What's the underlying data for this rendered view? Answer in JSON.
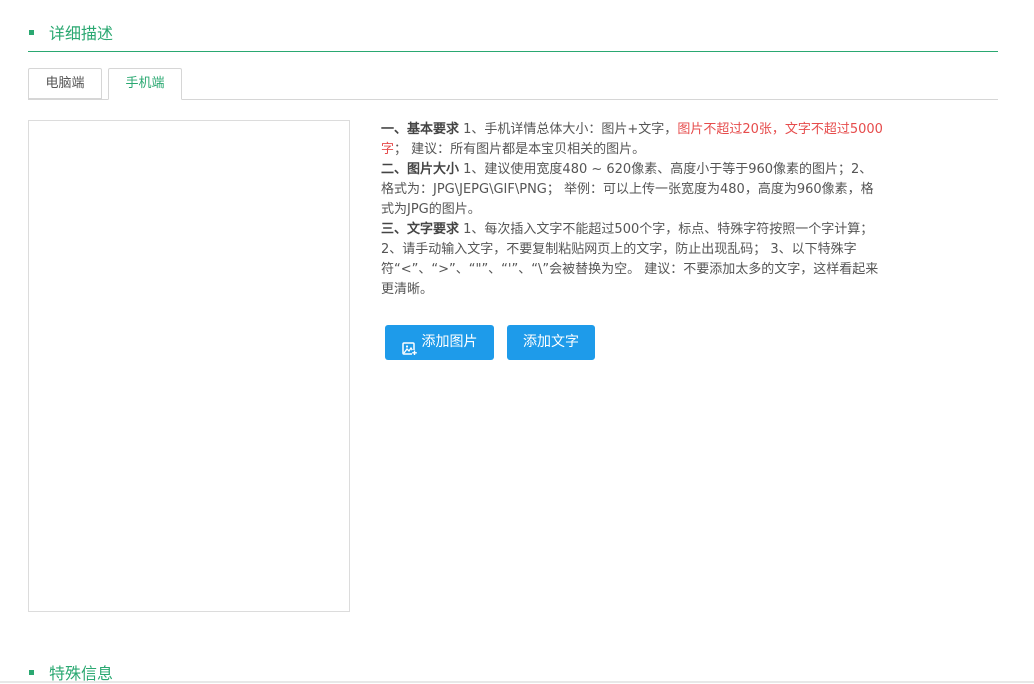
{
  "section_detail": {
    "title": "详细描述"
  },
  "tabs": [
    {
      "label": "电脑端"
    },
    {
      "label": "手机端"
    }
  ],
  "requirements": {
    "basic": {
      "heading": "一、基本要求",
      "text1": " 1、手机详情总体大小：图片+文字，",
      "highlight": "图片不超过20张，文字不超过5000字",
      "text2": "； 建议：所有图片都是本宝贝相关的图片。"
    },
    "image": {
      "heading": "二、图片大小",
      "text": " 1、建议使用宽度480 ~ 620像素、高度小于等于960像素的图片；2、格式为：JPG\\JEPG\\GIF\\PNG； 举例：可以上传一张宽度为480，高度为960像素，格式为JPG的图片。"
    },
    "text": {
      "heading": "三、文字要求",
      "text": " 1、每次插入文字不能超过500个字，标点、特殊字符按照一个字计算； 2、请手动输入文字，不要复制粘贴网页上的文字，防止出现乱码； 3、以下特殊字符“<”、“>”、“\"”、“'”、“\\”会被替换为空。 建议：不要添加太多的文字，这样看起来更清晰。"
    }
  },
  "buttons": {
    "add_image": "添加图片",
    "add_text": "添加文字"
  },
  "section_special": {
    "title": "特殊信息"
  },
  "colors": {
    "accent_green": "#2aa871",
    "button_blue": "#1e9bea",
    "highlight_red": "#e64c4c"
  },
  "icons": {
    "add_image": "image-add-icon"
  }
}
